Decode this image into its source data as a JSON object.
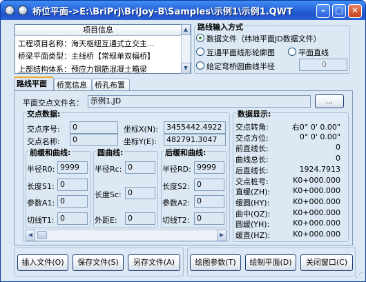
{
  "window": {
    "title": "桥位平面->E:\\BriPrj\\BriJoy-B\\Samples\\示例1\\示例1.QWT"
  },
  "project_info": {
    "header": "项目信息",
    "rows": [
      "工程项目名称：海天枢纽互通式立交主...",
      "桥梁平面类型：主线桥【常规单双幅桥】",
      "上部结构体系：预应力钢筋混凝土箱梁"
    ]
  },
  "route_input": {
    "title": "路线输入方式",
    "options": [
      "数据文件（纬地平面JD数据文件）",
      "互通平面线形轮廓图",
      "平面直线",
      "给定弯桥圆曲线半径"
    ],
    "radius_value": "0"
  },
  "tabs": [
    "路线平面",
    "桥宽信息",
    "桥孔布置"
  ],
  "file": {
    "label": "平面交点文件名：",
    "value": "示例1.JD",
    "browse": "..."
  },
  "jd": {
    "title": "交点数据:",
    "seq_label": "交点序号:",
    "seq_value": "0",
    "name_label": "交点名称:",
    "name_value": "0",
    "x_label": "坐标X(N):",
    "x_value": "3455442.4922",
    "y_label": "坐标Y(E):",
    "y_value": "482791.3047",
    "front": {
      "title": "前缓和曲线:",
      "r_label": "半径R0:",
      "r_value": "9999",
      "s_label": "长度S1:",
      "s_value": "0",
      "a_label": "参数A1:",
      "a_value": "0",
      "t_label": "切线T1:",
      "t_value": "0"
    },
    "circle": {
      "title": "圆曲线:",
      "r_label": "半径Rc:",
      "r_value": "0",
      "s_label": "长度Sc:",
      "s_value": "0",
      "e_label": "外距E:",
      "e_value": "0"
    },
    "back": {
      "title": "后缓和曲线:",
      "r_label": "半径RD:",
      "r_value": "9999",
      "s_label": "长度S2:",
      "s_value": "0",
      "a_label": "参数A2:",
      "a_value": "0",
      "t_label": "切线T2:",
      "t_value": "0"
    }
  },
  "display": {
    "title": "数据显示:",
    "rows": [
      {
        "label": "交点转角:",
        "value": "右0° 0' 0.00\""
      },
      {
        "label": "交点方位:",
        "value": "0° 0' 0.00\""
      },
      {
        "label": "前直线长:",
        "value": "0"
      },
      {
        "label": "曲线总长:",
        "value": "0"
      },
      {
        "label": "后直线长:",
        "value": "1924.7913"
      },
      {
        "label": "交点桩号:",
        "value": "K0+000.000"
      },
      {
        "label": "直缓(ZH):",
        "value": "K0+000.000"
      },
      {
        "label": "缓圆(HY):",
        "value": "K0+000.000"
      },
      {
        "label": "曲中(QZ):",
        "value": "K0+000.000"
      },
      {
        "label": "圆缓(YH):",
        "value": "K0+000.000"
      },
      {
        "label": "缓直(HZ):",
        "value": "K0+000.000"
      }
    ]
  },
  "buttons": {
    "insert": "插入文件(O)",
    "save": "保存文件(S)",
    "saveas": "另存文件(A)",
    "params": "绘图参数(T)",
    "draw": "绘制平面(D)",
    "close": "关闭窗口(C)"
  }
}
